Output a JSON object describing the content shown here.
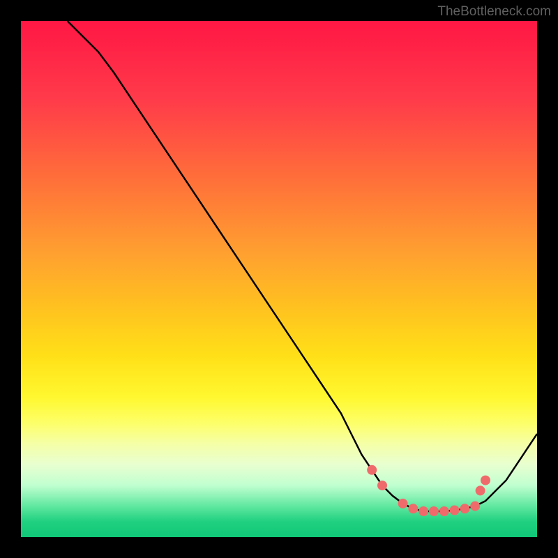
{
  "watermark": "TheBottleneck.com",
  "chart_data": {
    "type": "line",
    "title": "",
    "xlabel": "",
    "ylabel": "",
    "xlim": [
      0,
      100
    ],
    "ylim": [
      0,
      100
    ],
    "series": [
      {
        "name": "curve",
        "x": [
          9,
          12,
          15,
          18,
          22,
          26,
          30,
          34,
          38,
          42,
          46,
          50,
          54,
          58,
          62,
          64,
          66,
          68,
          70,
          72,
          74,
          76,
          78,
          80,
          82,
          84,
          86,
          88,
          90,
          92,
          94,
          96,
          98,
          100
        ],
        "y": [
          100,
          97,
          94,
          90,
          84,
          78,
          72,
          66,
          60,
          54,
          48,
          42,
          36,
          30,
          24,
          20,
          16,
          13,
          10,
          8,
          6.5,
          5.5,
          5,
          5,
          5,
          5.2,
          5.5,
          6,
          7,
          9,
          11,
          14,
          17,
          20
        ]
      }
    ],
    "markers": {
      "name": "dots",
      "x": [
        68,
        70,
        74,
        76,
        78,
        80,
        82,
        84,
        86,
        88,
        89,
        90
      ],
      "y": [
        13,
        10,
        6.5,
        5.5,
        5,
        5,
        5,
        5.2,
        5.5,
        6,
        9,
        11
      ]
    },
    "gradient_stops": [
      {
        "offset": 0,
        "color": "#ff1744"
      },
      {
        "offset": 15,
        "color": "#ff3a4a"
      },
      {
        "offset": 30,
        "color": "#ff6d3a"
      },
      {
        "offset": 45,
        "color": "#ffa030"
      },
      {
        "offset": 55,
        "color": "#ffc020"
      },
      {
        "offset": 65,
        "color": "#ffe018"
      },
      {
        "offset": 73,
        "color": "#fff830"
      },
      {
        "offset": 78,
        "color": "#fdff6a"
      },
      {
        "offset": 82,
        "color": "#f5ffa8"
      },
      {
        "offset": 86,
        "color": "#e8ffd0"
      },
      {
        "offset": 90,
        "color": "#c0ffd0"
      },
      {
        "offset": 94,
        "color": "#60e8a0"
      },
      {
        "offset": 97,
        "color": "#20d080"
      },
      {
        "offset": 100,
        "color": "#10c878"
      }
    ]
  }
}
